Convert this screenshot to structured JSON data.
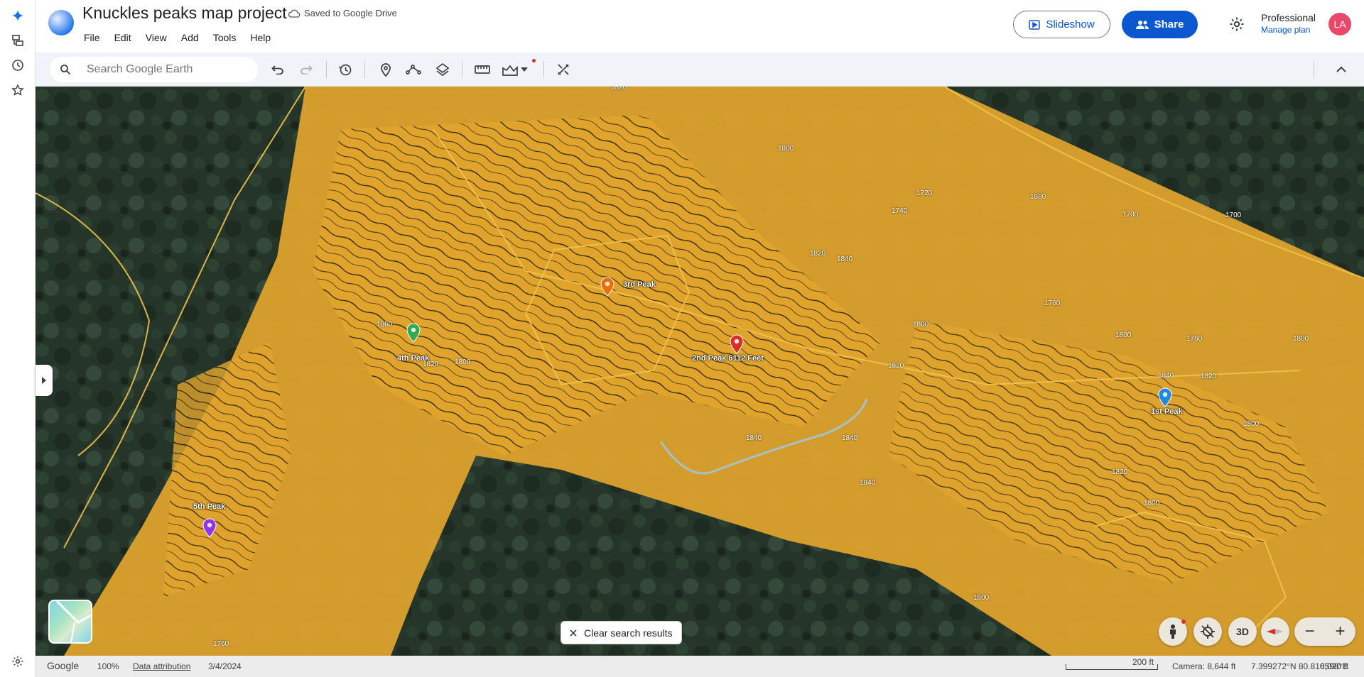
{
  "app": {
    "title": "Knuckles peaks map project",
    "saved_status": "Saved to Google Drive"
  },
  "menu": [
    "File",
    "Edit",
    "View",
    "Add",
    "Tools",
    "Help"
  ],
  "header": {
    "slideshow_label": "Slideshow",
    "share_label": "Share",
    "plan_name": "Professional",
    "manage_plan": "Manage plan",
    "avatar_initials": "LA"
  },
  "search": {
    "placeholder": "Search Google Earth"
  },
  "map": {
    "peaks": [
      {
        "label": "1st Peak",
        "color": "#1e88e5"
      },
      {
        "label": "2nd Peak 6112 Feet",
        "color": "#d93025"
      },
      {
        "label": "3rd Peak",
        "color": "#ef6c00"
      },
      {
        "label": "4th Peak",
        "color": "#34a853"
      },
      {
        "label": "5th Peak",
        "color": "#9334e6"
      }
    ],
    "contour_color": "#e8a92c",
    "clear_search_label": "Clear search results",
    "view_3d_label": "3D",
    "zoom_out": "−",
    "zoom_in": "+"
  },
  "status": {
    "brand": "Google",
    "zoom": "100%",
    "data_attribution": "Data attribution",
    "date": "3/4/2024",
    "scale": "200 ft",
    "camera": "Camera: 8,644 ft",
    "coords": "7.399272°N 80.810598°E",
    "elevation": "6,020 ft"
  }
}
